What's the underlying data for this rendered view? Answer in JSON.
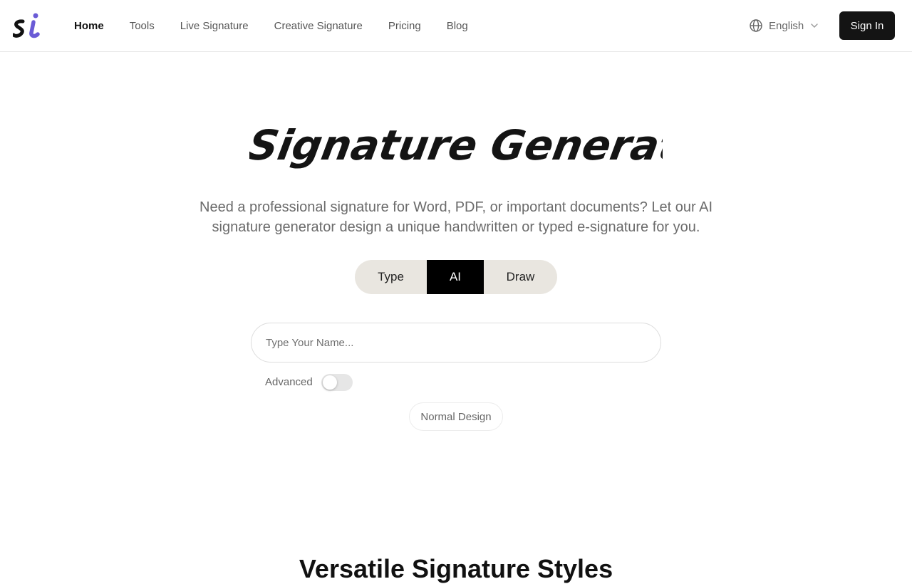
{
  "brand": {
    "accent": "#6a5bd6",
    "dark": "#111111"
  },
  "nav": {
    "items": [
      {
        "label": "Home",
        "active": true
      },
      {
        "label": "Tools"
      },
      {
        "label": "Live Signature"
      },
      {
        "label": "Creative Signature"
      },
      {
        "label": "Pricing"
      },
      {
        "label": "Blog"
      }
    ]
  },
  "header": {
    "language": "English",
    "language_icon": "globe-icon",
    "signin_label": "Sign In"
  },
  "hero": {
    "title": "Ai Signature Generator",
    "subtitle_line1": "Need a professional signature for Word, PDF, or important documents? Let our AI",
    "subtitle_line2": "signature generator design a unique handwritten or typed e-signature for you."
  },
  "tabs": [
    {
      "label": "Type"
    },
    {
      "label": "AI",
      "active": true
    },
    {
      "label": "Draw"
    }
  ],
  "input": {
    "placeholder": "Type Your Name...",
    "value": ""
  },
  "advanced": {
    "label": "Advanced",
    "enabled": false
  },
  "design_button": "Normal Design",
  "section": {
    "title": "Versatile Signature Styles"
  }
}
